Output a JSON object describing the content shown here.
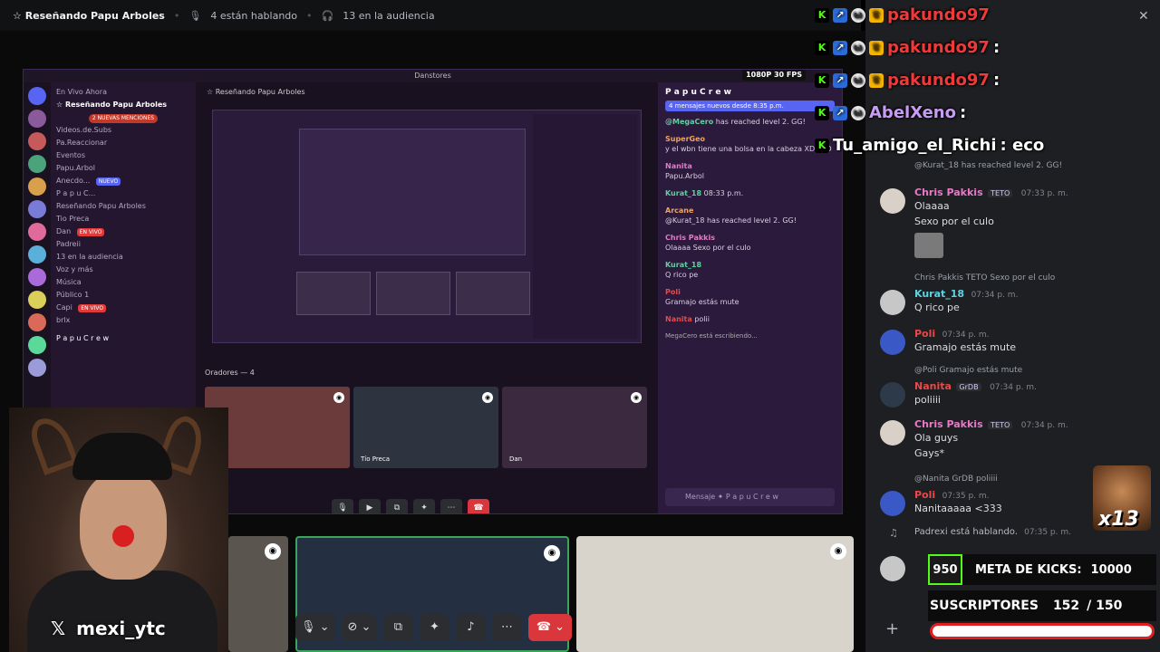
{
  "topbar": {
    "channel": "☆ Reseñando Papu Arboles",
    "speaking": "4 están hablando",
    "audience": "13 en la audiencia"
  },
  "share": {
    "server_title": "Danstores",
    "quality_badge": "1080P 30 FPS",
    "sidebar": {
      "live_now": "En Vivo Ahora",
      "channel": "☆ Reseñando Papu Arboles",
      "mentions_pill": "2 NUEVAS MENCIONES",
      "items": [
        "Videos.de.Subs",
        "Pa.Reaccionar",
        "Eventos",
        "Papu.Arbol",
        "Anecdo...",
        "P a p u  C...",
        "Reseñando Papu Arboles",
        "Tio Preca",
        "Dan",
        "Padreii",
        "13 en la audiencia",
        "Voz y más",
        "Música",
        "Público 1",
        "Capi",
        "brlx"
      ],
      "new_label": "NUEVO",
      "live_label": "EN VIVO",
      "live_label_2": "EN VIVO",
      "footer": "P a p u  C r e w"
    },
    "center_head": "☆ Reseñando Papu Arboles",
    "oradores": "Oradores — 4",
    "tile_labels": [
      "",
      "Tío Preca",
      "Dan"
    ],
    "chat": {
      "header": "P a p u  C r e w",
      "announcement": "4 mensajes nuevos desde 8:35 p.m.",
      "messages": [
        {
          "name": "@MegaCero",
          "text": "has reached level 2. GG!"
        },
        {
          "name": "SuperGeo",
          "text": "y el wbn tiene una bolsa en la cabeza XDDDD"
        },
        {
          "name": "Nanita",
          "text": "Papu.Arbol"
        },
        {
          "name": "Kurat_18",
          "text": "08:33 p.m."
        },
        {
          "name": "Arcane",
          "text": "@Kurat_18 has reached level 2. GG!"
        },
        {
          "name": "Chris Pakkis",
          "text": "Olaaaa  Sexo por el culo"
        },
        {
          "name": "Kurat_18",
          "text": "Q rico pe"
        },
        {
          "name": "Poli",
          "text": "Gramajo estás mute"
        },
        {
          "name": "Nanita",
          "text": "polii"
        }
      ],
      "typing": "MegaCero está escribiendo...",
      "input_placeholder": "Mensaje ✦ P a p u  C r e w"
    }
  },
  "webcam": {
    "handle": "mexi_ytc",
    "x_icon": "𝕏"
  },
  "right_chat": {
    "messages": [
      {
        "reply": "@Kurat_18 has reached level 2. GG!",
        "name": "",
        "time": "",
        "text": ""
      },
      {
        "name": "Chris Pakkis",
        "badge": "TETO",
        "time": "07:33 p. m.",
        "lines": [
          "Olaaaa",
          "Sexo por el culo"
        ],
        "color": "#e67ac7"
      },
      {
        "reply": "Chris Pakkis TETO Sexo por el culo",
        "name": "Kurat_18",
        "time": "07:34 p. m.",
        "lines": [
          "Q rico pe"
        ],
        "color": "#5fd1e0"
      },
      {
        "name": "Poli",
        "time": "07:34 p. m.",
        "lines": [
          "Gramajo estás mute"
        ],
        "color": "#e64a4a"
      },
      {
        "reply": "@Poli Gramajo estás mute",
        "name": "Nanita",
        "badge": "GrDB",
        "time": "07:34 p. m.",
        "lines": [
          "poliiii"
        ],
        "color": "#e64a4a"
      },
      {
        "name": "Chris Pakkis",
        "badge": "TETO",
        "time": "07:34 p. m.",
        "lines": [
          "Ola guys",
          "Gays*"
        ],
        "color": "#e67ac7"
      },
      {
        "reply": "@Nanita GrDB poliiii",
        "name": "Poli",
        "time": "07:35 p. m.",
        "lines": [
          "Nanitaaaaa <333"
        ],
        "color": "#e64a4a"
      },
      {
        "system": "Padrexi está hablando.",
        "time": "07:35 p. m."
      }
    ]
  },
  "overlay_chat": [
    {
      "name": "pakundo97",
      "text": "",
      "color": "#f03a3a"
    },
    {
      "name": "pakundo97",
      "text": ":",
      "color": "#f03a3a"
    },
    {
      "name": "pakundo97",
      "text": ":",
      "color": "#f03a3a"
    },
    {
      "name": "AbelXeno",
      "text": ":",
      "color": "#c89cf5"
    },
    {
      "name": "Tu_amigo_el_Richi",
      "text": ": eco",
      "color": "#ffffff"
    }
  ],
  "goals": {
    "kicks_count": "950",
    "kicks_label": "META DE KICKS:",
    "kicks_goal": "10000",
    "subs_label": "SUSCRIPTORES",
    "subs_current": "152",
    "subs_goal": "/ 150",
    "subs_progress": 1.0
  },
  "emote_counter": "x13",
  "icons": {
    "mic": "microphone-icon",
    "camera": "camera-icon",
    "share": "screen-share-icon",
    "hangup": "hangup-icon",
    "more": "more-icon"
  }
}
